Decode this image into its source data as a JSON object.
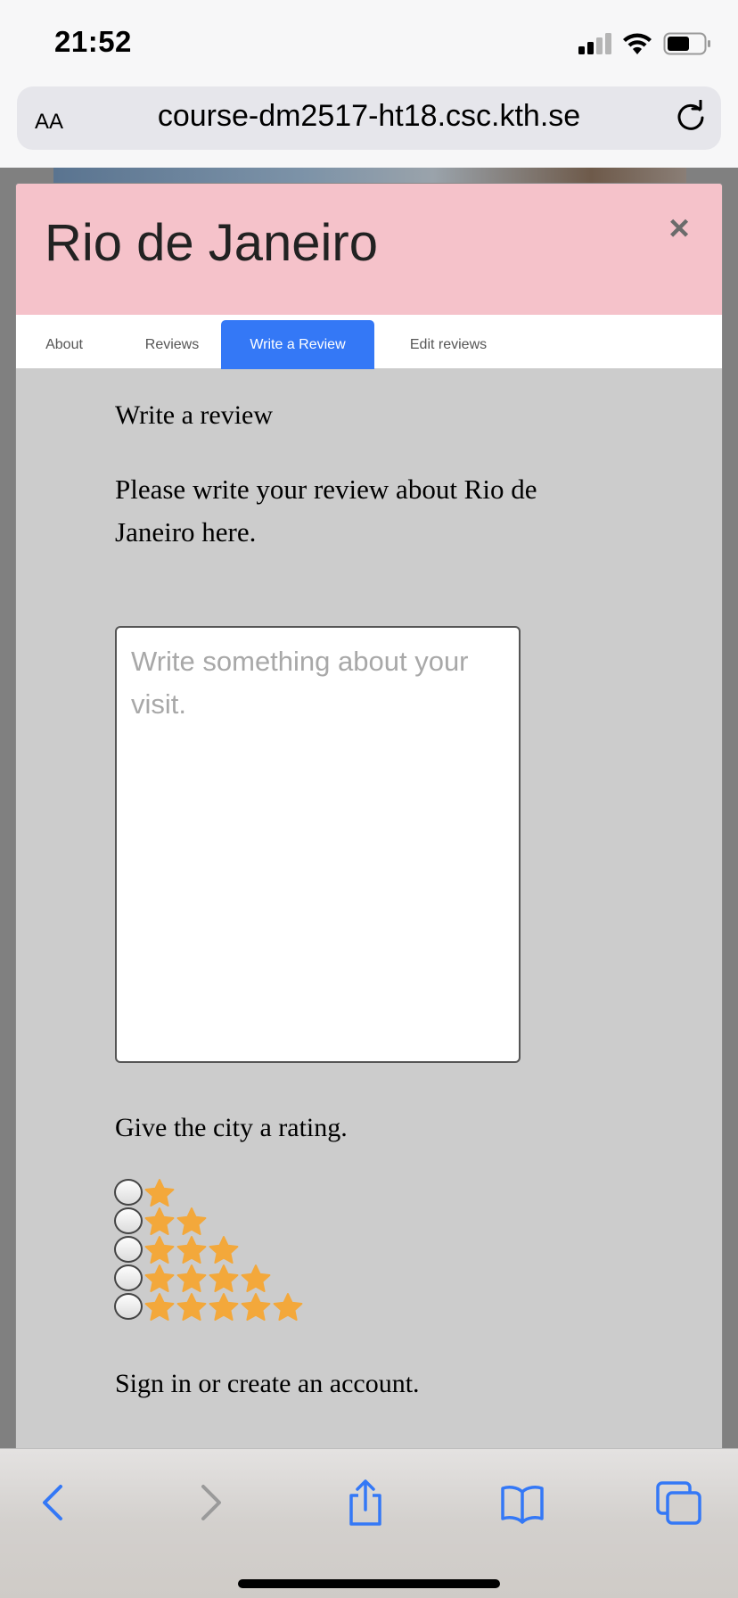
{
  "status_bar": {
    "time": "21:52"
  },
  "browser": {
    "text_size_label": "AA",
    "url": "course-dm2517-ht18.csc.kth.se"
  },
  "modal": {
    "title": "Rio de Janeiro",
    "close_symbol": "×",
    "tabs": [
      {
        "label": "About",
        "active": false
      },
      {
        "label": "Reviews",
        "active": false
      },
      {
        "label": "Write a Review",
        "active": true
      },
      {
        "label": "Edit reviews",
        "active": false
      }
    ],
    "heading": "Write a review",
    "intro": "Please write your review about Rio de Janeiro here.",
    "review_placeholder": "Write something about your visit.",
    "rating_label": "Give the city a rating.",
    "rating_options": [
      1,
      2,
      3,
      4,
      5
    ],
    "signin_text": "Sign in or create an account."
  },
  "colors": {
    "header_bg": "#f5c2ca",
    "active_tab": "#3478f6",
    "star": "#f3a83b",
    "toolbar_icon": "#3478f6"
  },
  "icons": {
    "status": [
      "cellular-signal-icon",
      "wifi-icon",
      "battery-icon"
    ],
    "browser": [
      "reload-icon"
    ],
    "toolbar": [
      "back-icon",
      "forward-icon",
      "share-icon",
      "bookmarks-icon",
      "tabs-icon"
    ]
  }
}
